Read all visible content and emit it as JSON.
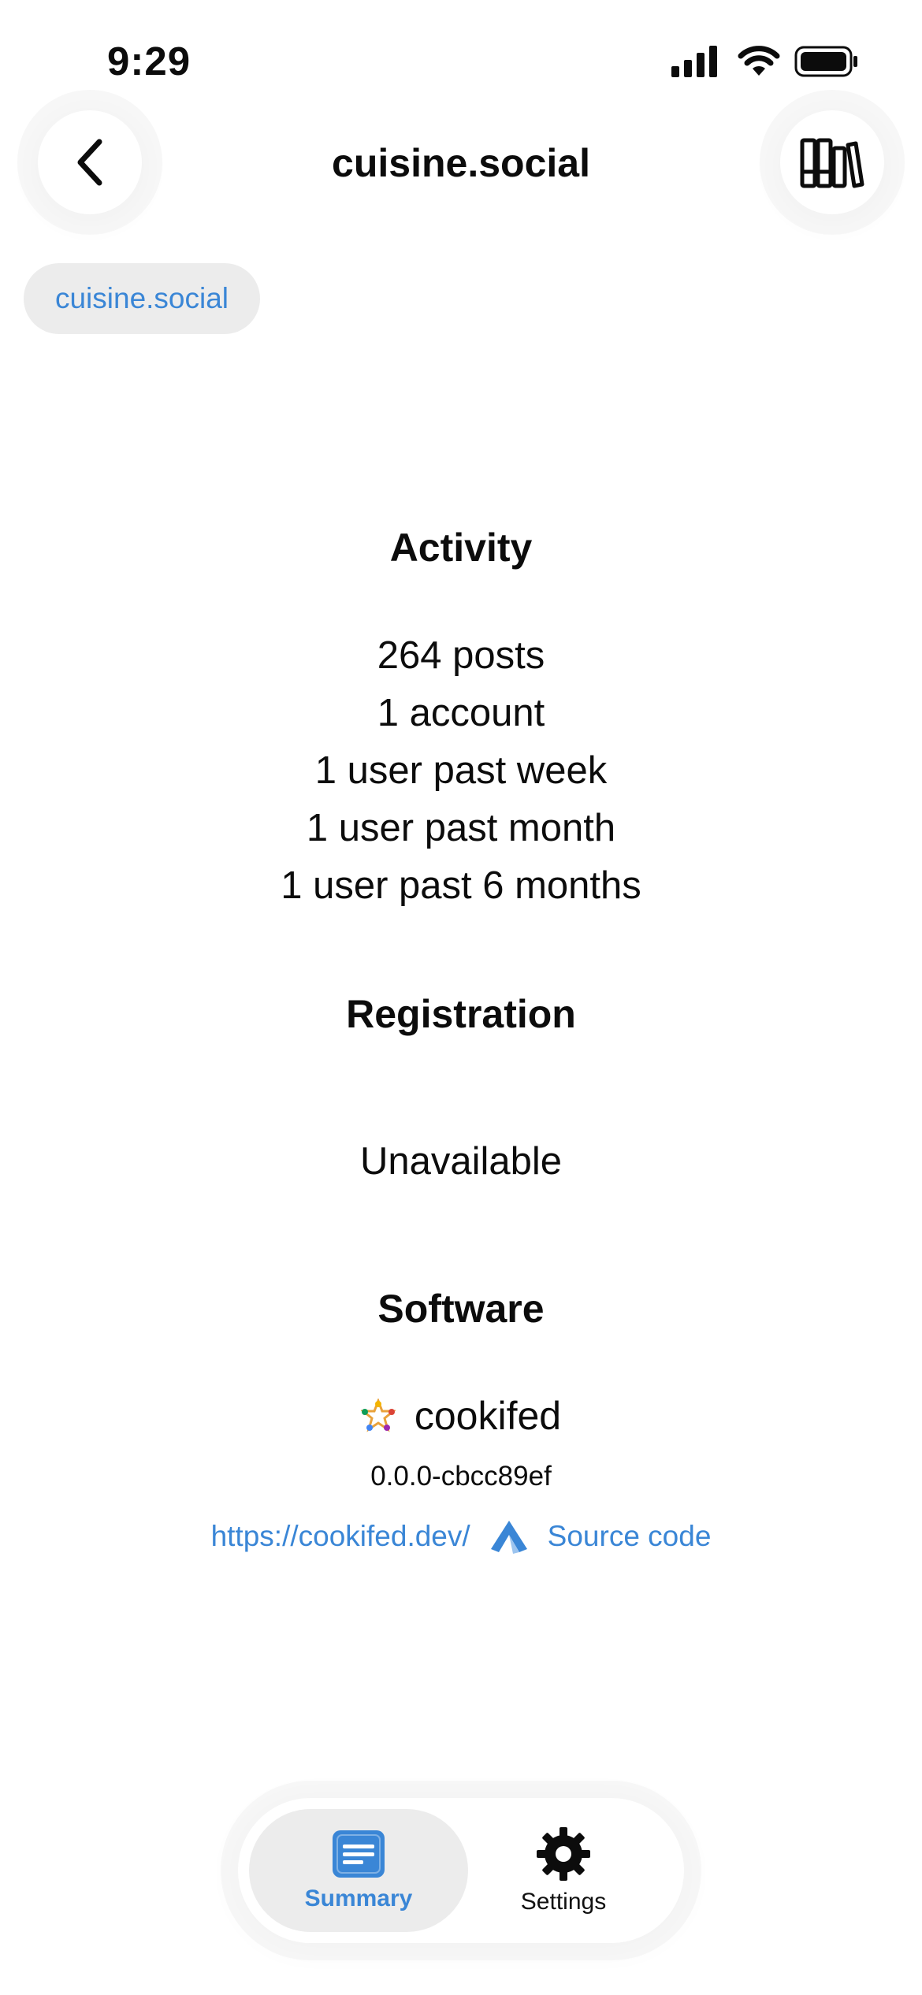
{
  "status_bar": {
    "time": "9:29"
  },
  "nav": {
    "title": "cuisine.social"
  },
  "chip": {
    "label": "cuisine.social"
  },
  "activity": {
    "title": "Activity",
    "lines": [
      "264 posts",
      "1 account",
      "1 user past week",
      "1 user past month",
      "1 user past 6 months"
    ]
  },
  "registration": {
    "title": "Registration",
    "value": "Unavailable"
  },
  "software": {
    "title": "Software",
    "name": "cookifed",
    "version": "0.0.0-cbcc89ef",
    "homepage": "https://cookifed.dev/",
    "source_label": "Source code"
  },
  "tabs": [
    {
      "label": "Summary",
      "icon": "summary-icon",
      "active": true
    },
    {
      "label": "Settings",
      "icon": "gear-icon",
      "active": false
    }
  ],
  "colors": {
    "accent": "#3a86d6",
    "chip_bg": "#ececec",
    "text": "#0c0c0c"
  }
}
